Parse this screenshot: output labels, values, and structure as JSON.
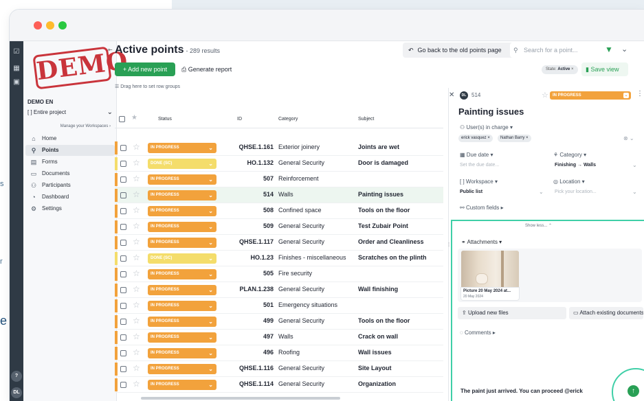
{
  "backdrop": {
    "left_fragments": [
      "s",
      "r",
      "e"
    ]
  },
  "rail": {
    "avatar_initials": "DL",
    "help_glyph": "?"
  },
  "sidebar": {
    "logo_text": "DEMO",
    "project_name": "DEMO EN",
    "project_selector": "Entire project",
    "manage_workspaces": "Manage your Workspaces",
    "items": [
      {
        "label": "Home",
        "icon": "home-icon",
        "glyph": "⌂"
      },
      {
        "label": "Points",
        "icon": "pin-icon",
        "glyph": "⚲"
      },
      {
        "label": "Forms",
        "icon": "clipboard-icon",
        "glyph": "▤"
      },
      {
        "label": "Documents",
        "icon": "folder-icon",
        "glyph": "▭"
      },
      {
        "label": "Participants",
        "icon": "users-icon",
        "glyph": "⚇"
      },
      {
        "label": "Dashboard",
        "icon": "dashboard-icon",
        "glyph": "◔"
      },
      {
        "label": "Settings",
        "icon": "gear-icon",
        "glyph": "⚙"
      }
    ]
  },
  "header": {
    "title": "Active points",
    "results": "- 289 results",
    "back_button": "Go back to the old points page",
    "search_placeholder": "Search for a point...",
    "add_button": "+ Add new point",
    "report_button": "Generate report",
    "state_label": "State:",
    "state_value": "Active",
    "save_view": "Save view"
  },
  "table": {
    "drag_hint": "Drag here to set row groups",
    "columns": {
      "status": "Status",
      "id": "ID",
      "category": "Category",
      "subject": "Subject"
    },
    "rows": [
      {
        "status": "IN PROGRESS",
        "done": false,
        "id": "QHSE.1.161",
        "category": "Exterior joinery",
        "subject": "Joints are wet"
      },
      {
        "status": "DONE (SC)",
        "done": true,
        "id": "HO.1.132",
        "category": "General Security",
        "subject": "Door is damaged"
      },
      {
        "status": "IN PROGRESS",
        "done": false,
        "id": "507",
        "category": "Reinforcement",
        "subject": ""
      },
      {
        "status": "IN PROGRESS",
        "done": false,
        "id": "514",
        "category": "Walls",
        "subject": "Painting issues",
        "selected": true
      },
      {
        "status": "IN PROGRESS",
        "done": false,
        "id": "508",
        "category": "Confined space",
        "subject": "Tools on the floor"
      },
      {
        "status": "IN PROGRESS",
        "done": false,
        "id": "509",
        "category": "General Security",
        "subject": "Test Zubair Point"
      },
      {
        "status": "IN PROGRESS",
        "done": false,
        "id": "QHSE.1.117",
        "category": "General Security",
        "subject": "Order and Cleanliness"
      },
      {
        "status": "DONE (SC)",
        "done": true,
        "id": "HO.1.23",
        "category": "Finishes - miscellaneous",
        "subject": "Scratches on the plinth"
      },
      {
        "status": "IN PROGRESS",
        "done": false,
        "id": "505",
        "category": "Fire security",
        "subject": ""
      },
      {
        "status": "IN PROGRESS",
        "done": false,
        "id": "PLAN.1.238",
        "category": "General Security",
        "subject": "Wall finishing"
      },
      {
        "status": "IN PROGRESS",
        "done": false,
        "id": "501",
        "category": "Emergency situations",
        "subject": ""
      },
      {
        "status": "IN PROGRESS",
        "done": false,
        "id": "499",
        "category": "General Security",
        "subject": "Tools on the floor"
      },
      {
        "status": "IN PROGRESS",
        "done": false,
        "id": "497",
        "category": "Walls",
        "subject": "Crack on wall"
      },
      {
        "status": "IN PROGRESS",
        "done": false,
        "id": "496",
        "category": "Roofing",
        "subject": "Wall issues"
      },
      {
        "status": "IN PROGRESS",
        "done": false,
        "id": "QHSE.1.116",
        "category": "General Security",
        "subject": "Site Layout"
      },
      {
        "status": "IN PROGRESS",
        "done": false,
        "id": "QHSE.1.114",
        "category": "General Security",
        "subject": "Organization"
      }
    ]
  },
  "detail": {
    "avatar": "DL",
    "point_id": "514",
    "status": "IN PROGRESS",
    "title": "Painting issues",
    "users_label": "User(s) in charge",
    "users": [
      "erick vasquez",
      "Nathan Barry"
    ],
    "due_label": "Due date",
    "due_placeholder": "Set the due date...",
    "category_label": "Category",
    "category_value": "Finishing → Walls",
    "workspace_label": "Workspace",
    "workspace_value": "Public list",
    "location_label": "Location",
    "location_placeholder": "Pick your location...",
    "custom_fields": "Custom fields",
    "show_less": "Show less...",
    "attachments_label": "Attachments",
    "attachment_title": "Picture 20 May 2024 at...",
    "attachment_date": "20 May 2024",
    "upload_button": "Upload new files",
    "attach_button": "Attach existing documents",
    "comments_label": "Comments",
    "comment_text": "The paint just arrived. You can proceed @erick"
  },
  "colors": {
    "accent_green": "#29a055",
    "in_progress": "#f2a23c",
    "done": "#f4dd6b",
    "highlight": "#3fcfa7",
    "demo_red": "#c9343b"
  }
}
